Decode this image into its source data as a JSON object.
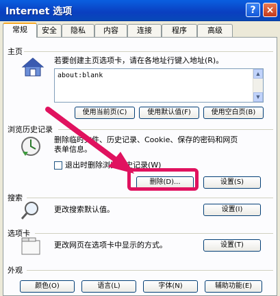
{
  "window": {
    "title": "Internet 选项",
    "help": "?",
    "close": "×"
  },
  "tabs": [
    "常规",
    "安全",
    "隐私",
    "内容",
    "连接",
    "程序",
    "高级"
  ],
  "home": {
    "section": "主页",
    "description": "若要创建主页选项卡，请在各地址行键入地址(R)。",
    "url": "about:blank",
    "buttons": [
      "使用当前页(C)",
      "使用默认值(F)",
      "使用空白页(B)"
    ]
  },
  "history": {
    "section": "浏览历史记录",
    "line1": "删除临时文件、历史记录、Cookie、保存的密码和网页",
    "line2": "表单信息。",
    "checkbox_label": "退出时删除浏览历史记录(W)",
    "delete_button": "删除(D)...",
    "settings_button": "设置(S)"
  },
  "search": {
    "section": "搜索",
    "description": "更改搜索默认值。",
    "settings_button": "设置(I)"
  },
  "tabsec": {
    "section": "选项卡",
    "description": "更改网页在选项卡中显示的方式。",
    "settings_button": "设置(T)"
  },
  "appearance": {
    "section": "外观",
    "buttons": [
      "颜色(O)",
      "语言(L)",
      "字体(N)",
      "辅助功能(E)"
    ]
  },
  "colors": {
    "titlebar": "#0a4fd0",
    "highlight": "#e0125f",
    "panel": "#fcfcfe"
  }
}
